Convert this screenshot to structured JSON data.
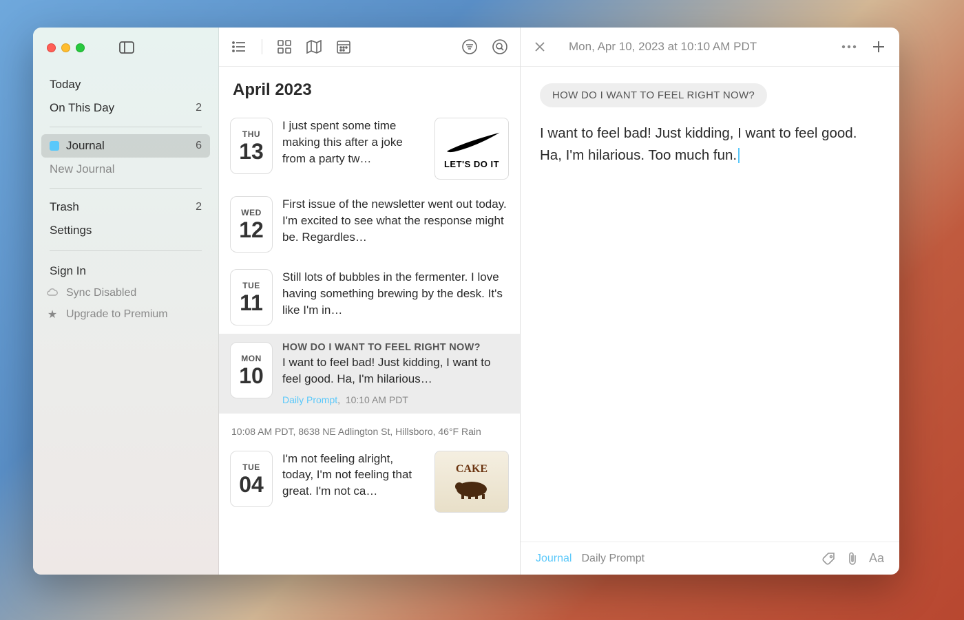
{
  "sidebar": {
    "items": [
      {
        "label": "Today",
        "count": ""
      },
      {
        "label": "On This Day",
        "count": "2"
      }
    ],
    "journals": [
      {
        "label": "Journal",
        "count": "6",
        "selected": true
      },
      {
        "label": "New Journal",
        "count": ""
      }
    ],
    "system": [
      {
        "label": "Trash",
        "count": "2"
      },
      {
        "label": "Settings",
        "count": ""
      }
    ],
    "signin": "Sign In",
    "sync": "Sync Disabled",
    "upgrade": "Upgrade to Premium"
  },
  "entryList": {
    "monthHeader": "April 2023",
    "entries": [
      {
        "dow": "THU",
        "dnum": "13",
        "text": "I just spent some time making this after a joke from a party tw…",
        "thumb": "nike",
        "thumbText": "LET'S DO IT"
      },
      {
        "dow": "WED",
        "dnum": "12",
        "text": "First issue of the newsletter went out today. I'm excited to see what the response might be. Regardles…"
      },
      {
        "dow": "TUE",
        "dnum": "11",
        "text": "Still lots of bubbles in the fermenter. I love having something brewing by the desk. It's like I'm in…"
      },
      {
        "dow": "MON",
        "dnum": "10",
        "promptLine": "HOW DO I WANT TO FEEL RIGHT NOW?",
        "text": "I want to feel bad! Just kidding, I want to feel good. Ha, I'm hilarious…",
        "metaPrompt": "Daily Prompt",
        "metaTime": "10:10 AM PDT",
        "selected": true
      },
      {
        "dow": "TUE",
        "dnum": "04",
        "text": "I'm not feeling alright, today, I'm not feeling that great. I'm not ca…",
        "thumb": "cake",
        "thumbText": "CAKE"
      }
    ],
    "context": "10:08 AM PDT,  8638 NE Adlington St, Hillsboro,  46°F Rain"
  },
  "detail": {
    "timestamp": "Mon, Apr 10, 2023 at 10:10 AM PDT",
    "promptPill": "HOW DO I WANT TO FEEL RIGHT NOW?",
    "body": "I want to feel bad! Just kidding, I want to feel good. Ha, I'm hilarious. Too much fun.",
    "journalLink": "Journal",
    "promptLabel": "Daily Prompt"
  }
}
